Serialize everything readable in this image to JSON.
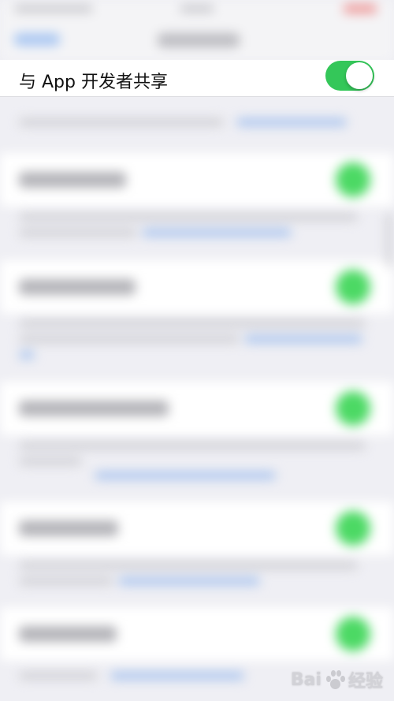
{
  "share_row": {
    "label": "与 App 开发者共享",
    "toggle_on": true
  },
  "colors": {
    "toggle_on": "#34c759",
    "background": "#efeff4"
  },
  "watermark": {
    "text_left": "Bai",
    "text_right": "经验"
  }
}
